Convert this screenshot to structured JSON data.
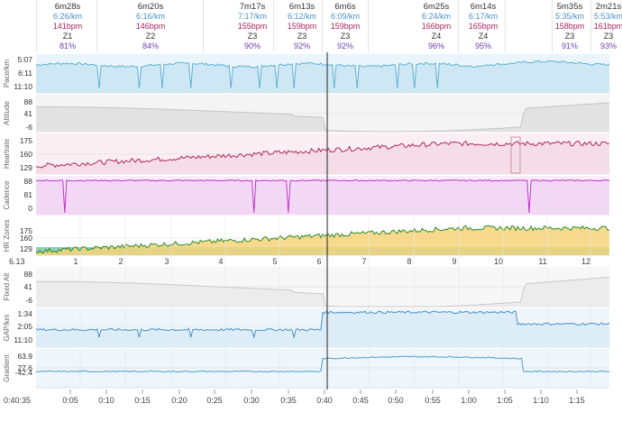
{
  "laps": [
    {
      "duration": "6m28s",
      "pace": "6:26/km",
      "hr": "141bpm",
      "zone": "Z1",
      "pct": "81%"
    },
    {
      "duration": "6m20s",
      "pace": "6:16/km",
      "hr": "146bpm",
      "zone": "Z2",
      "pct": "84%"
    },
    {
      "duration": "7m17s",
      "pace": "7:17/km",
      "hr": "155bpm",
      "zone": "Z3",
      "pct": "90%"
    },
    {
      "duration": "6m13s",
      "pace": "6:12/km",
      "hr": "159bpm",
      "zone": "Z3",
      "pct": "92%"
    },
    {
      "duration": "6m6s",
      "pace": "6:09/km",
      "hr": "159bpm",
      "zone": "Z3",
      "pct": "92%"
    },
    {
      "duration": "6m25s",
      "pace": "6:24/km",
      "hr": "166bpm",
      "zone": "Z4",
      "pct": "96%"
    },
    {
      "duration": "6m14s",
      "pace": "6:17/km",
      "hr": "165bpm",
      "zone": "Z4",
      "pct": "95%"
    },
    {
      "duration": "5m35s",
      "pace": "5:35/km",
      "hr": "158bpm",
      "zone": "Z3",
      "pct": "91%"
    },
    {
      "duration": "2m21s",
      "pace": "5:53/km",
      "hr": "161bpm",
      "zone": "Z3",
      "pct": "93%"
    }
  ],
  "chart_data": {
    "type": "line",
    "cursor_time": "0:40:35",
    "x_ticks": [
      "0:05",
      "0:10",
      "0:15",
      "0:20",
      "0:25",
      "0:30",
      "0:35",
      "0:40",
      "0:45",
      "0:50",
      "0:55",
      "1:00",
      "1:05",
      "1:10",
      "1:15"
    ],
    "distance_marks": [
      "6.13",
      "1",
      "2",
      "3",
      "4",
      "5",
      "6",
      "7",
      "8",
      "9",
      "10",
      "11",
      "12"
    ],
    "panels": [
      {
        "label": "Pace/km",
        "ticks": [
          "5:07",
          "6:11",
          "11:10"
        ],
        "color": "#5fb0d4"
      },
      {
        "label": "Altitude",
        "ticks": [
          "88",
          "41",
          "-6"
        ],
        "color": "#9a9a9a"
      },
      {
        "label": "Heartrate",
        "ticks": [
          "175",
          "160",
          "129"
        ],
        "color": "#b0285e"
      },
      {
        "label": "Cadence",
        "ticks": [
          "88",
          "81",
          "0"
        ],
        "color": "#c030c8"
      },
      {
        "label": "HR Zones",
        "ticks": [
          "175",
          "160",
          "129"
        ],
        "color": "#e8a020"
      },
      {
        "label": "Fixed Alt",
        "ticks": [
          "88",
          "41",
          "-6"
        ],
        "color": "#b0b0b0"
      },
      {
        "label": "GAP/km",
        "ticks": [
          "1:34",
          "2:05",
          "11:10"
        ],
        "color": "#4a90c8"
      },
      {
        "label": "Gradient",
        "ticks": [
          "63.9",
          "27.6",
          "-42.4"
        ],
        "color": "#4aa0c8"
      }
    ]
  }
}
